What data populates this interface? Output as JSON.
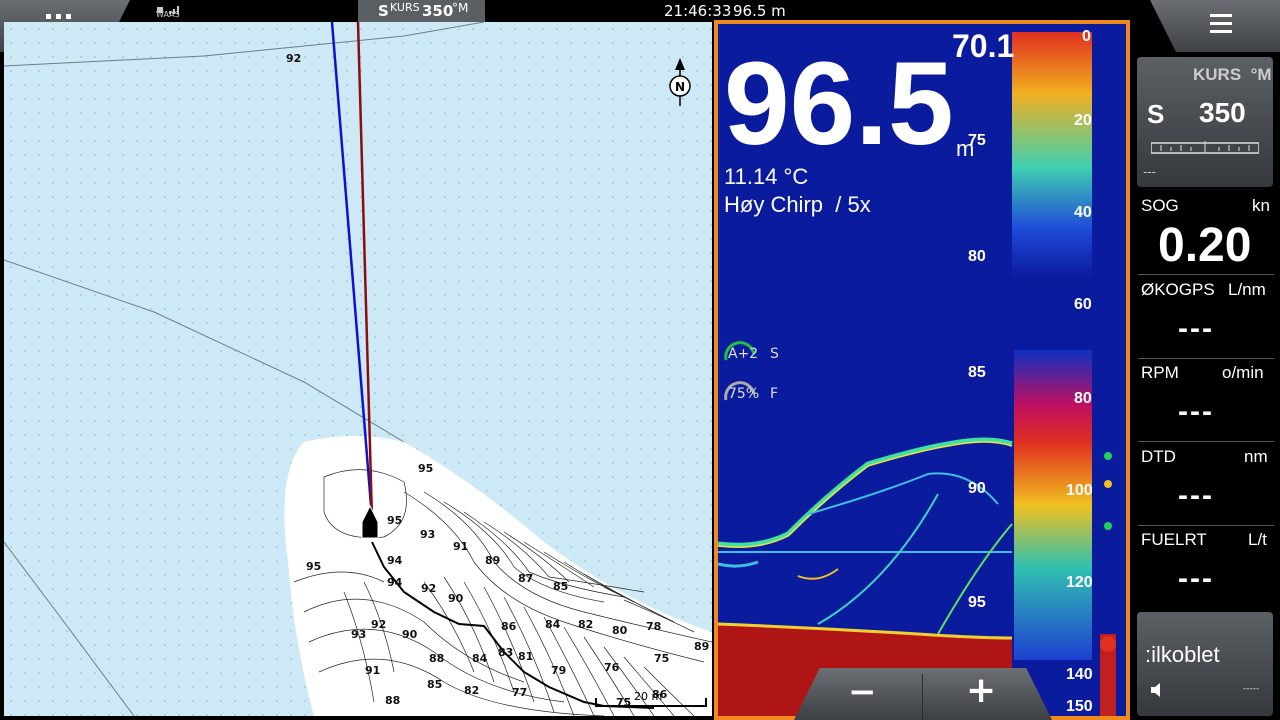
{
  "topbar": {
    "waas_label": "WAAS",
    "heading_prefix": "S",
    "heading_kurs": "KURS",
    "heading_value": "350",
    "heading_unit": "°M",
    "time": "21:46:33",
    "depth": "96.5 m"
  },
  "chart": {
    "north_label": "N",
    "scale_label": "20 m",
    "depth_labels": [
      "92",
      "95",
      "95",
      "95",
      "93",
      "94",
      "91",
      "89",
      "94",
      "92",
      "90",
      "87",
      "85",
      "93",
      "92",
      "90",
      "86",
      "84",
      "82",
      "80",
      "78",
      "91",
      "88",
      "84",
      "83",
      "81",
      "79",
      "76",
      "75",
      "89",
      "88",
      "85",
      "82",
      "77",
      "75",
      "86"
    ]
  },
  "sonar": {
    "depth_value": "96.5",
    "depth_unit": "m",
    "temp": "11.14 °C",
    "mode": "Høy Chirp  / 5x",
    "upper_right": "70.1",
    "scale_main": [
      "75",
      "80",
      "85",
      "90",
      "95"
    ],
    "scale_zoom_top": [
      "0",
      "20",
      "40",
      "60"
    ],
    "scale_zoom_bottom": [
      "80",
      "100",
      "120",
      "140",
      "150"
    ],
    "gain_label": "A+2",
    "gain_letter": "S",
    "filter_label": "75%",
    "filter_letter": "F",
    "zoom_minus": "−",
    "zoom_plus": "+"
  },
  "panel": {
    "heading_title": "KURS  °M",
    "heading_prefix": "S",
    "heading_value": "350",
    "heading_dashes": "---",
    "sog_label": "SOG",
    "sog_unit": "kn",
    "sog_value": "0.20",
    "fuel_eco_label": "ØKOGPS",
    "fuel_eco_unit": "L/nm",
    "fuel_eco_value": "---",
    "rpm_label": "RPM",
    "rpm_unit": "o/min",
    "rpm_value": "---",
    "dtd_label": "DTD",
    "dtd_unit": "nm",
    "dtd_value": "---",
    "fuelrt_label": "FUELRT",
    "fuelrt_unit": "L/t",
    "fuelrt_value": "---",
    "audio_status": ":ilkoblet",
    "audio_dashes": "-----"
  },
  "colors": {
    "accent": "#f18a1e",
    "sea": "#cde9f5",
    "sonar_bg": "#0b1b9e",
    "bottom": "#b01515"
  }
}
